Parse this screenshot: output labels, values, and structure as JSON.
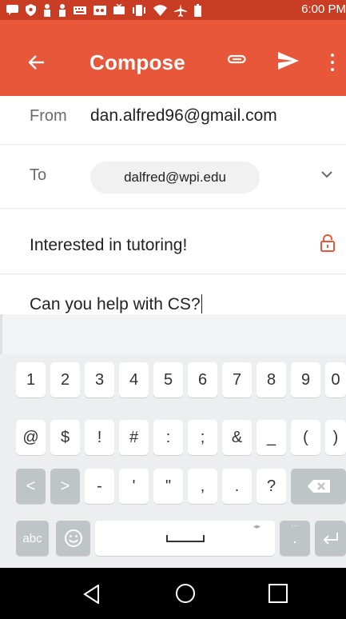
{
  "status_bar": {
    "time": "6:00 PM",
    "icons": [
      "message-icon",
      "shield-icon",
      "person-icon",
      "person-icon",
      "keyboard-icon",
      "voicemail-icon",
      "tv-icon",
      "vibrate-icon",
      "wifi-icon",
      "airplane-icon",
      "battery-icon"
    ]
  },
  "app_bar": {
    "title": "Compose",
    "back_icon": "arrow-left-icon",
    "attach_icon": "paperclip-icon",
    "send_icon": "send-icon",
    "more_icon": "more-vertical-icon"
  },
  "compose": {
    "from_label": "From",
    "from_value": "dan.alfred96@gmail.com",
    "to_label": "To",
    "to_chip": "dalfred@wpi.edu",
    "subject": "Interested in tutoring!",
    "body": "Can you help with CS?"
  },
  "keyboard": {
    "row1": [
      "1",
      "2",
      "3",
      "4",
      "5",
      "6",
      "7",
      "8",
      "9",
      "0"
    ],
    "row2": [
      "@",
      "$",
      "!",
      "#",
      ":",
      ";",
      "&",
      "_",
      "(",
      ")"
    ],
    "row3": [
      "<",
      ">",
      "-",
      "'",
      "\"",
      ",",
      ".",
      "?"
    ],
    "abc_label": "abc"
  },
  "colors": {
    "status_bar": "#c83d24",
    "app_bar": "#e9573a",
    "lock": "#e9573a"
  }
}
